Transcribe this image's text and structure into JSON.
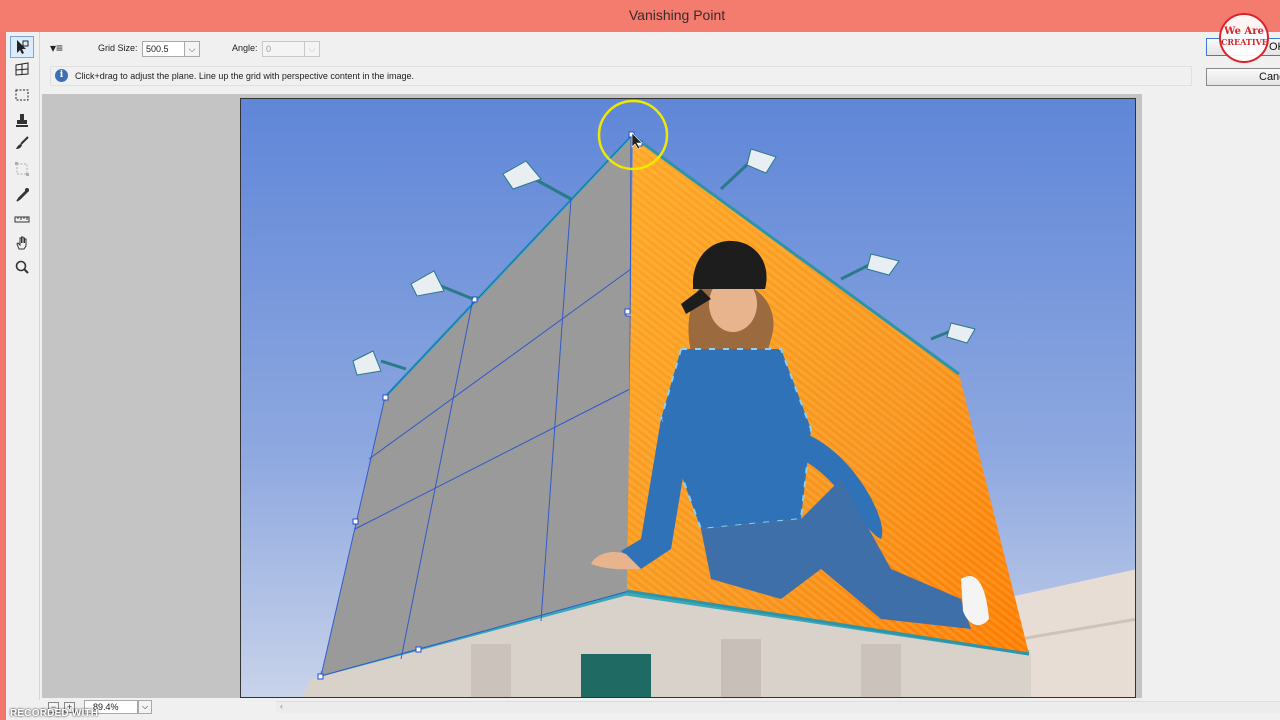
{
  "window": {
    "title": "Vanishing Point"
  },
  "options": {
    "grid_size_label": "Grid Size:",
    "grid_size_value": "500.5",
    "angle_label": "Angle:",
    "angle_value": "0"
  },
  "info": {
    "icon": "info-icon",
    "text": "Click+drag to adjust the plane. Line up the grid with perspective content in the image."
  },
  "buttons": {
    "ok": "OK",
    "cancel": "Cancel"
  },
  "tools": [
    {
      "name": "edit-plane-tool",
      "icon": "arrow-cursor-icon",
      "active": true
    },
    {
      "name": "create-plane-tool",
      "icon": "grid-plus-icon",
      "active": false
    },
    {
      "name": "marquee-tool",
      "icon": "dashed-rect-icon",
      "active": false
    },
    {
      "name": "stamp-tool",
      "icon": "stamp-icon",
      "active": false
    },
    {
      "name": "brush-tool",
      "icon": "brush-icon",
      "active": false
    },
    {
      "name": "transform-tool",
      "icon": "transform-icon",
      "active": false
    },
    {
      "name": "eyedropper-tool",
      "icon": "eyedropper-icon",
      "active": false
    },
    {
      "name": "measure-tool",
      "icon": "ruler-icon",
      "active": false
    },
    {
      "name": "hand-tool",
      "icon": "hand-icon",
      "active": false
    },
    {
      "name": "zoom-tool",
      "icon": "magnifier-icon",
      "active": false
    }
  ],
  "status": {
    "zoom": "89.4%",
    "zoom_out": "−",
    "zoom_in": "+"
  },
  "watermark": "RECORDED WITH",
  "logo": {
    "line1": "We Are",
    "line2": "CREATIVE"
  },
  "colors": {
    "title_bar": "#f47c6e",
    "accent": "#3d7bd0",
    "plane_grid": "#1f4fd0",
    "billboard_orange": "#f7931e",
    "sky": "#6e92dc"
  }
}
